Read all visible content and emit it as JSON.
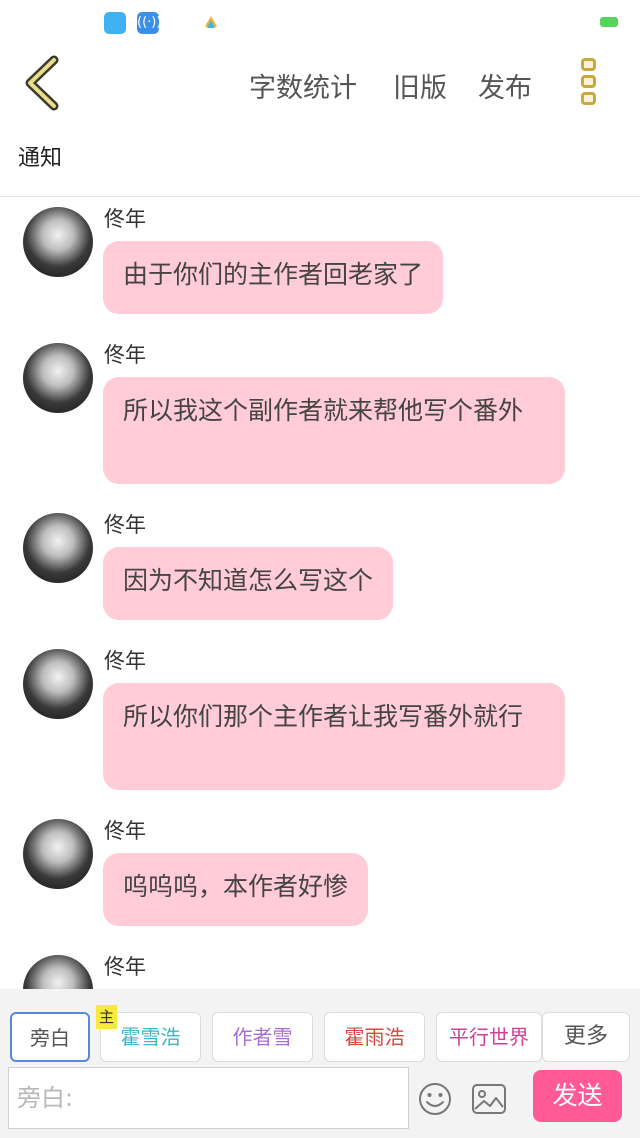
{
  "status_bar": {
    "icons": [
      "app-icon",
      "wifi-hotspot-icon",
      "colorful-app-icon",
      "battery-icon"
    ]
  },
  "toolbar": {
    "back_icon": "chevron-left-icon",
    "word_count": "字数统计",
    "old_version": "旧版",
    "publish": "发布",
    "more_icon": "three-squares-icon"
  },
  "notice": "通知",
  "messages": [
    {
      "sender": "佟年",
      "text": "由于你们的主作者回老家了"
    },
    {
      "sender": "佟年",
      "text": "所以我这个副作者就来帮他写个番外"
    },
    {
      "sender": "佟年",
      "text": "因为不知道怎么写这个"
    },
    {
      "sender": "佟年",
      "text": "所以你们那个主作者让我写番外就行"
    },
    {
      "sender": "佟年",
      "text": "呜呜呜，本作者好惨"
    },
    {
      "sender": "佟年",
      "text": ""
    }
  ],
  "characters": {
    "narration": "旁白",
    "main_badge": "主",
    "list": [
      "霍雪浩",
      "作者雪",
      "霍雨浩",
      "平行世界"
    ],
    "more": "更多"
  },
  "input": {
    "placeholder": "旁白:"
  },
  "send_label": "发送",
  "colors": {
    "bubble": "#ffccd8",
    "send": "#ff5a95",
    "accent_yellow": "#c9a83c"
  }
}
